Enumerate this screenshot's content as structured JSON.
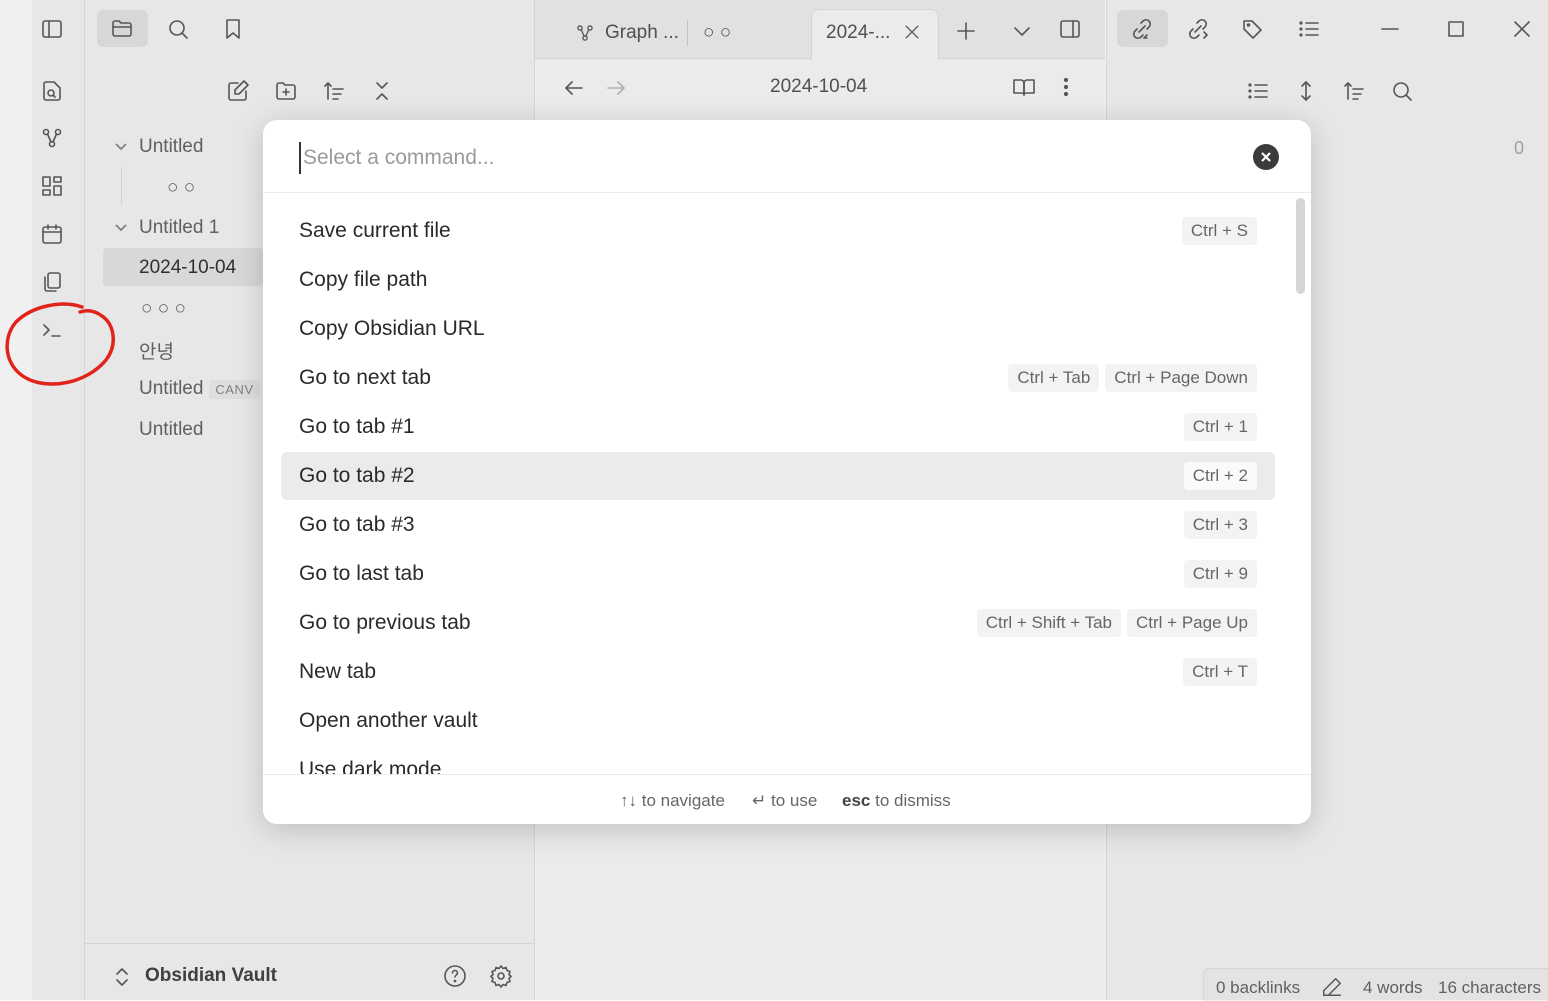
{
  "tabs": [
    {
      "label": "Graph ...",
      "icon": "graph-icon"
    },
    {
      "label": "○ ○"
    },
    {
      "label": "2024-...",
      "active": true
    }
  ],
  "note": {
    "title": "2024-10-04"
  },
  "file_tree": [
    {
      "label": "Untitled",
      "type": "folder",
      "expanded": true
    },
    {
      "label": "○ ○",
      "type": "file",
      "indent": 2
    },
    {
      "label": "Untitled 1",
      "type": "folder",
      "expanded": true
    },
    {
      "label": "2024-10-04",
      "type": "file",
      "selected": true
    },
    {
      "label": "○ ○ ○",
      "type": "file"
    },
    {
      "label": "안녕",
      "type": "file"
    },
    {
      "label": "Untitled",
      "type": "file",
      "badge": "CANV"
    },
    {
      "label": "Untitled",
      "type": "file"
    }
  ],
  "vault": {
    "name": "Obsidian Vault"
  },
  "right_panel": {
    "count": "0"
  },
  "status_bar": {
    "backlinks": "0 backlinks",
    "words": "4 words",
    "characters": "16 characters"
  },
  "command_palette": {
    "placeholder": "Select a command...",
    "commands": [
      {
        "label": "Save current file",
        "keys": [
          "Ctrl + S"
        ]
      },
      {
        "label": "Copy file path",
        "keys": []
      },
      {
        "label": "Copy Obsidian URL",
        "keys": []
      },
      {
        "label": "Go to next tab",
        "keys": [
          "Ctrl + Tab",
          "Ctrl + Page Down"
        ]
      },
      {
        "label": "Go to tab #1",
        "keys": [
          "Ctrl + 1"
        ]
      },
      {
        "label": "Go to tab #2",
        "keys": [
          "Ctrl + 2"
        ],
        "selected": true
      },
      {
        "label": "Go to tab #3",
        "keys": [
          "Ctrl + 3"
        ]
      },
      {
        "label": "Go to last tab",
        "keys": [
          "Ctrl + 9"
        ]
      },
      {
        "label": "Go to previous tab",
        "keys": [
          "Ctrl + Shift + Tab",
          "Ctrl + Page Up"
        ]
      },
      {
        "label": "New tab",
        "keys": [
          "Ctrl + T"
        ]
      },
      {
        "label": "Open another vault",
        "keys": []
      },
      {
        "label": "Use dark mode",
        "keys": []
      }
    ],
    "footer": {
      "navigate_key": "↑↓",
      "navigate_text": "to navigate",
      "use_key": "↵",
      "use_text": "to use",
      "dismiss_key": "esc",
      "dismiss_text": "to dismiss"
    }
  }
}
